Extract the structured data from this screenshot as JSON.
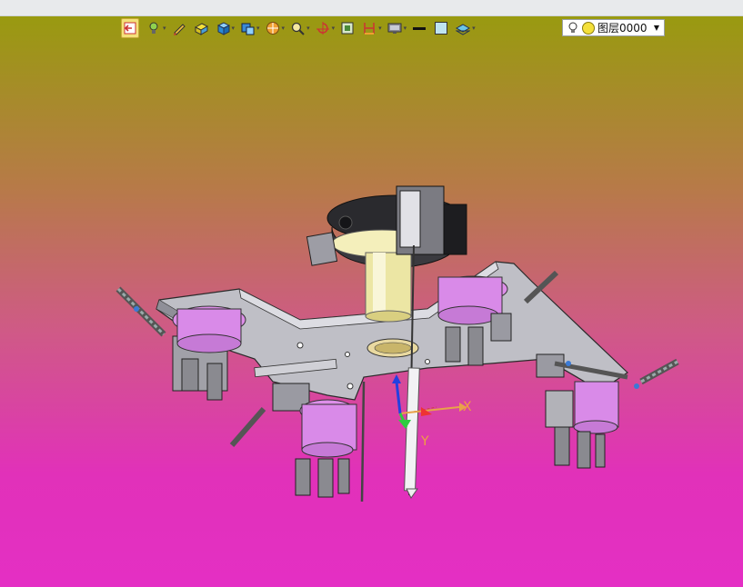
{
  "toolbar": {
    "buttons": [
      {
        "name": "exit-sketch",
        "icon": "exit-icon",
        "dropdown": false,
        "active": true
      },
      {
        "name": "highlight",
        "icon": "bulb-paint-icon",
        "dropdown": true
      },
      {
        "name": "pencil",
        "icon": "pencil-icon",
        "dropdown": false
      },
      {
        "name": "solid-shading",
        "icon": "yellow-box-icon",
        "dropdown": false
      },
      {
        "name": "view-cube",
        "icon": "blue-cube-icon",
        "dropdown": true
      },
      {
        "name": "display-mode",
        "icon": "display-mode-icon",
        "dropdown": true
      },
      {
        "name": "render-ball",
        "icon": "orange-ball-icon",
        "dropdown": true
      },
      {
        "name": "zoom",
        "icon": "magnifier-icon",
        "dropdown": true
      },
      {
        "name": "rotate",
        "icon": "rotate-axis-icon",
        "dropdown": true
      },
      {
        "name": "section",
        "icon": "section-view-icon",
        "dropdown": false
      },
      {
        "name": "measure",
        "icon": "measure-icon",
        "dropdown": true
      },
      {
        "name": "monitor",
        "icon": "monitor-icon",
        "dropdown": true
      },
      {
        "name": "line-style",
        "icon": "line-weight-icon",
        "dropdown": false
      },
      {
        "name": "color-fill",
        "icon": "color-square-icon",
        "dropdown": false
      },
      {
        "name": "layer-props",
        "icon": "layer-stack-icon",
        "dropdown": true
      }
    ]
  },
  "layer": {
    "label": "图层0000",
    "icons": [
      "lightbulb-icon",
      "sun-icon",
      "dropdown-arrow-icon"
    ]
  },
  "triad": {
    "x_label": "X",
    "y_label": "Y"
  },
  "colors": {
    "bg_top": "#999a10",
    "bg_bottom": "#e42fc4",
    "plate": "#c9c9cf",
    "cylinder_magenta": "#d98ae8",
    "hub_yellow": "#eee6a0",
    "x_axis": "#e8a34a",
    "y_axis": "#2ecc40",
    "z_axis": "#2340e0"
  }
}
